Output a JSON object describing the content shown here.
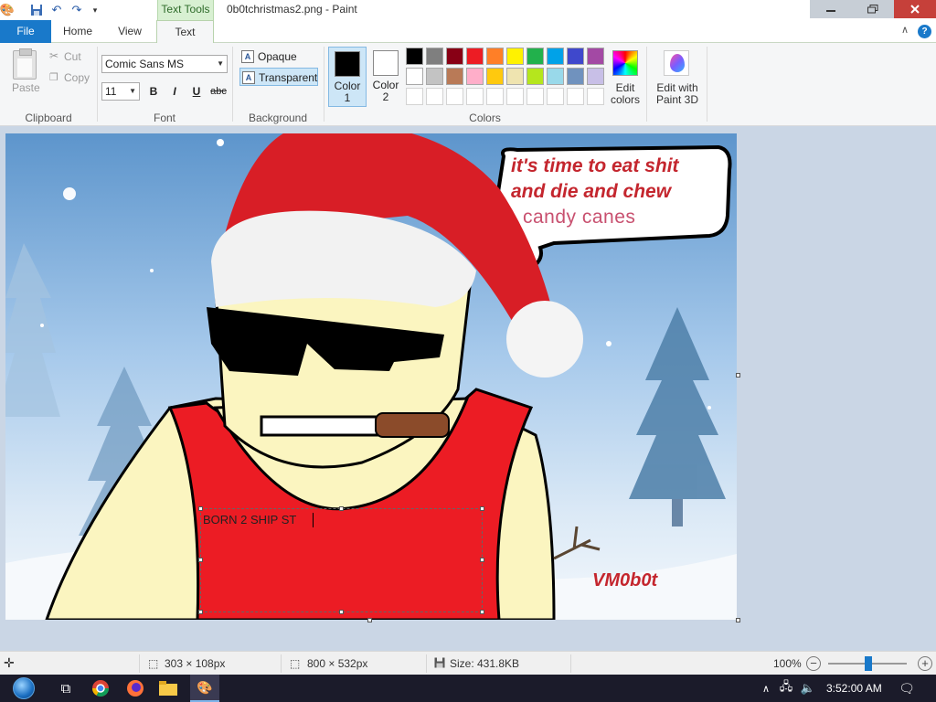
{
  "window": {
    "title": "0b0tchristmas2.png - Paint",
    "context_tab": "Text Tools"
  },
  "tabs": {
    "file": "File",
    "home": "Home",
    "view": "View",
    "text": "Text"
  },
  "ribbon": {
    "clipboard": {
      "paste": "Paste",
      "cut": "Cut",
      "copy": "Copy",
      "label": "Clipboard"
    },
    "font": {
      "family": "Comic Sans MS",
      "size": "11",
      "bold": "B",
      "italic": "I",
      "underline": "U",
      "strike": "abc",
      "label": "Font"
    },
    "background": {
      "opaque": "Opaque",
      "transparent": "Transparent",
      "label": "Background"
    },
    "colors": {
      "color1_label": "Color",
      "color1_num": "1",
      "color2_label": "Color",
      "color2_num": "2",
      "color1": "#000000",
      "color2": "#ffffff",
      "label": "Colors",
      "palette_row1": [
        "#000000",
        "#7f7f7f",
        "#880015",
        "#ed1c24",
        "#ff7f27",
        "#fff200",
        "#22b14c",
        "#00a2e8",
        "#3f48cc",
        "#a349a4"
      ],
      "palette_row2": [
        "#ffffff",
        "#c3c3c3",
        "#b97a57",
        "#ffaec9",
        "#ffc90e",
        "#efe4b0",
        "#b5e61d",
        "#99d9ea",
        "#7092be",
        "#c8bfe7"
      ],
      "edit_colors_1": "Edit",
      "edit_colors_2": "colors",
      "paint3d_1": "Edit with",
      "paint3d_2": "Paint 3D"
    }
  },
  "canvas": {
    "speech_line1": "it's time to eat shit",
    "speech_line2": "and die and chew",
    "speech_line3": "candy canes",
    "signature": "VM0b0t",
    "text_box_content": "BORN 2 SHIP ST"
  },
  "statusbar": {
    "selection_size": "303 × 108px",
    "canvas_size": "800 × 532px",
    "file_size": "Size: 431.8KB",
    "zoom": "100%"
  },
  "taskbar": {
    "time": "3:52:00 AM"
  }
}
